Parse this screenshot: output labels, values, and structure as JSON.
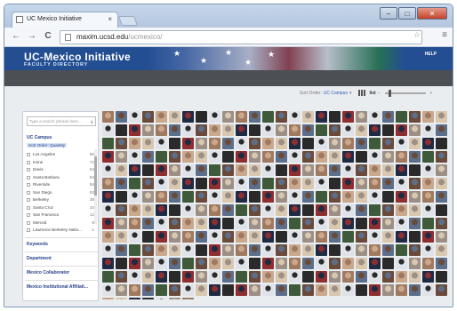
{
  "browser": {
    "tab_title": "UC Mexico Initiative",
    "tab_close": "×",
    "url_host": "maxim.ucsd.edu",
    "url_path": "/ucmexico/",
    "back": "←",
    "forward": "→",
    "reload": "C",
    "star": "☆",
    "menu": "≡",
    "min": "–",
    "max": "□",
    "close": "✕"
  },
  "site": {
    "title": "UC-Mexico Initiative",
    "subtitle": "Faculty Directory",
    "help": "HELP"
  },
  "sort": {
    "label": "Sort Order:",
    "value": "UC Campus",
    "caret": "▾",
    "list": "list",
    "minus": "–",
    "plus": "+"
  },
  "sidebar": {
    "search_placeholder": "Type a search phrase here...",
    "search_icon": "⚲",
    "campus_heading": "UC Campus",
    "sort_quantity": "Sort Order: Quantity",
    "campuses": [
      {
        "name": "Los Angeles",
        "count": "86"
      },
      {
        "name": "Irvine",
        "count": "71"
      },
      {
        "name": "Davis",
        "count": "54"
      },
      {
        "name": "Santa Barbara",
        "count": "54"
      },
      {
        "name": "Riverside",
        "count": "54"
      },
      {
        "name": "San Diego",
        "count": "53"
      },
      {
        "name": "Berkeley",
        "count": "38"
      },
      {
        "name": "Santa Cruz",
        "count": "34"
      },
      {
        "name": "San Francisco",
        "count": "12"
      },
      {
        "name": "Merced",
        "count": "9"
      },
      {
        "name": "Lawrence Berkeley Natio...",
        "count": "1"
      }
    ],
    "sections": [
      "Keywords",
      "Department",
      "Mexico Collaborator",
      "Mexico Institutional Affiliati..."
    ]
  },
  "directory": {
    "portrait_count": 371,
    "portrait_colors": [
      "#6b4a3a",
      "#a07a60",
      "#2a2a2a",
      "#c9a88c",
      "#5c6f8a",
      "#8f2e2e",
      "#d9c7b0",
      "#3f5a3a",
      "#9b8f86",
      "#1f2a44"
    ]
  }
}
